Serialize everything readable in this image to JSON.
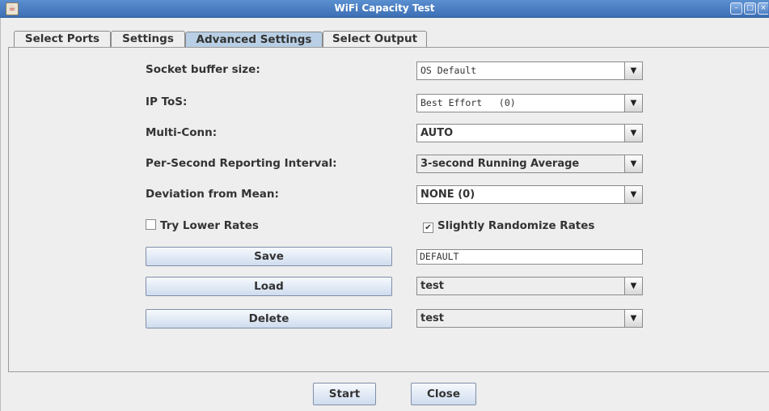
{
  "window": {
    "title": "WiFi Capacity Test"
  },
  "tabs": [
    {
      "label": "Select Ports"
    },
    {
      "label": "Settings"
    },
    {
      "label": "Advanced Settings"
    },
    {
      "label": "Select Output"
    }
  ],
  "active_tab": "Advanced Settings",
  "fields": {
    "socket_buffer": {
      "label": "Socket buffer size:",
      "value": "OS Default"
    },
    "ip_tos": {
      "label": "IP ToS:",
      "value": "Best Effort   (0)"
    },
    "multi_conn": {
      "label": "Multi-Conn:",
      "value": "AUTO"
    },
    "reporting_interval": {
      "label": "Per-Second Reporting Interval:",
      "value": "3-second Running Average"
    },
    "deviation": {
      "label": "Deviation from Mean:",
      "value": "NONE (0)"
    }
  },
  "checkboxes": {
    "try_lower_rates": {
      "label": "Try Lower Rates",
      "checked": false
    },
    "slightly_randomize": {
      "label": "Slightly Randomize Rates",
      "checked": true
    }
  },
  "profile": {
    "save_label": "Save",
    "save_name": "DEFAULT",
    "load_label": "Load",
    "load_value": "test",
    "delete_label": "Delete",
    "delete_value": "test"
  },
  "footer": {
    "start_label": "Start",
    "close_label": "Close"
  },
  "colors": {
    "titlebar": "#4a7fc1",
    "active_tab": "#b8cfe5",
    "window_bg": "#eeeeee"
  }
}
